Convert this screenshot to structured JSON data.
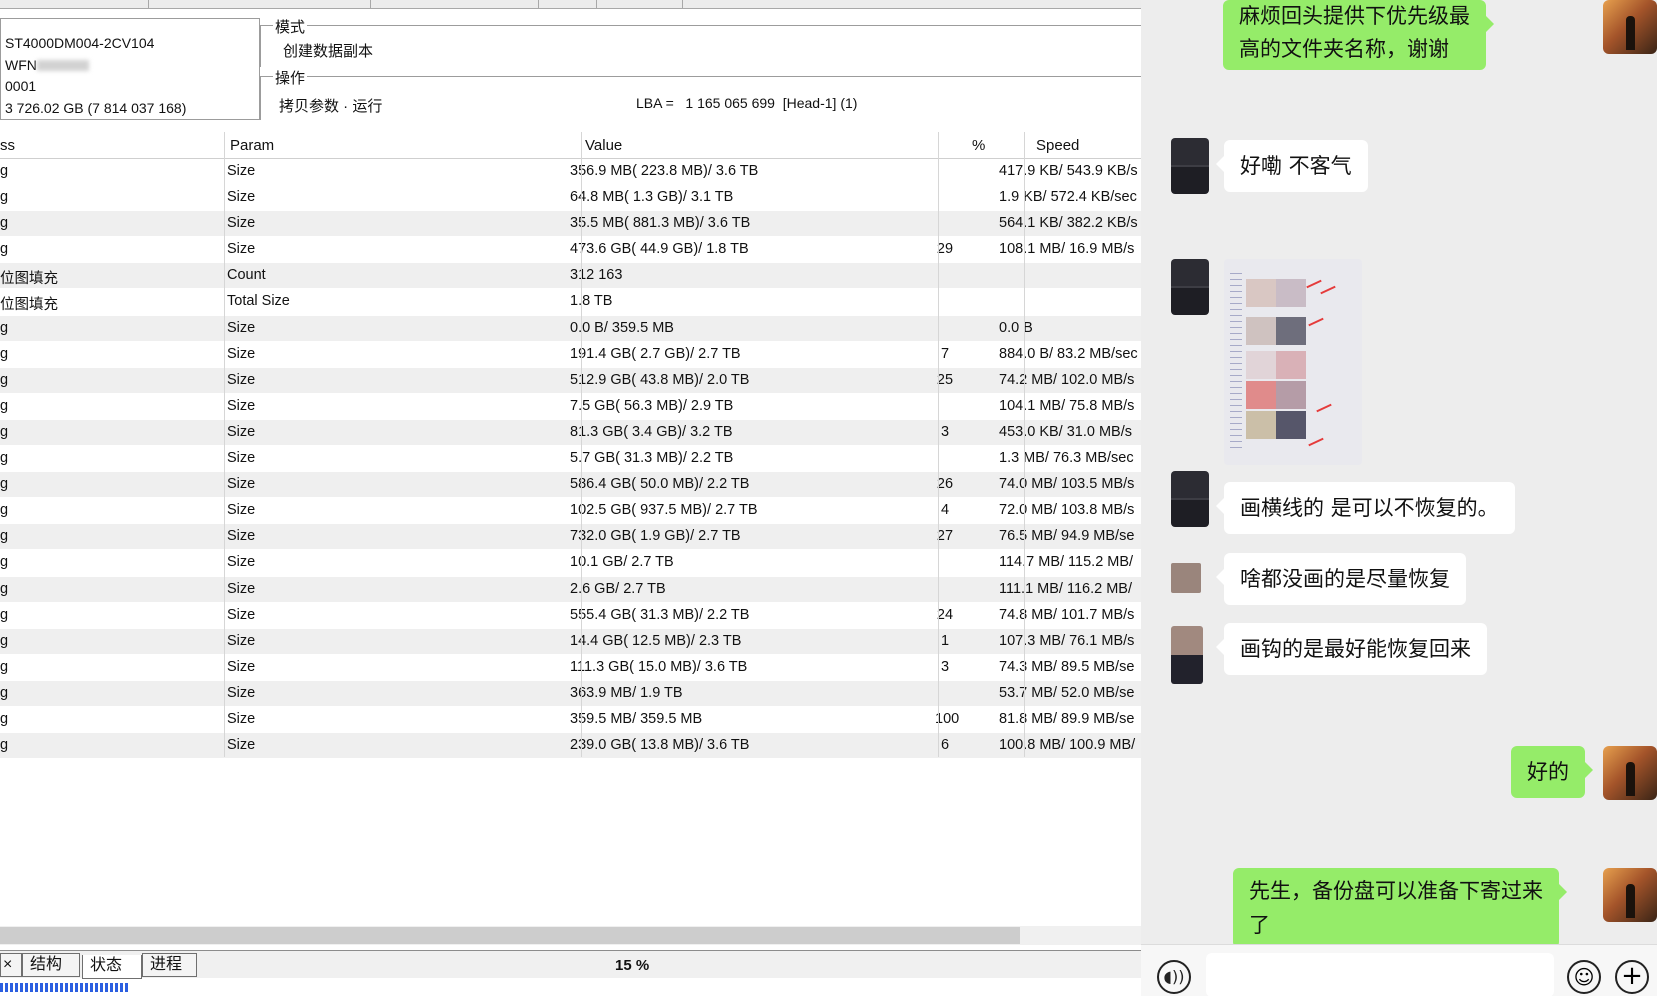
{
  "device": {
    "model": "ST4000DM004-2CV104",
    "serial_visible": "WFN",
    "firmware": "0001",
    "capacity": "3 726.02 GB (7 814 037 168)"
  },
  "mode": {
    "legend": "模式",
    "value": "创建数据副本"
  },
  "operation": {
    "legend": "操作",
    "value": "拷贝参数 · 运行",
    "lba": "LBA =   1 165 065 699  [Head-1] (1)"
  },
  "grid": {
    "headers": [
      "ss",
      "Param",
      "Value",
      "%",
      "Speed"
    ],
    "rows": [
      {
        "c0": "g",
        "param": "Size",
        "value": "356.9 MB( 223.8 MB)/ 3.6 TB",
        "pct": "",
        "speed": "417.9 KB/ 543.9 KB/s"
      },
      {
        "c0": "g",
        "param": "Size",
        "value": "64.8 MB( 1.3 GB)/ 3.1 TB",
        "pct": "",
        "speed": "1.9 KB/ 572.4 KB/sec"
      },
      {
        "c0": "g",
        "param": "Size",
        "value": "35.5 MB( 881.3 MB)/ 3.6 TB",
        "pct": "",
        "speed": "564.1 KB/ 382.2 KB/s"
      },
      {
        "c0": "g",
        "param": "Size",
        "value": "473.6 GB( 44.9 GB)/ 1.8 TB",
        "pct": "29",
        "speed": "108.1 MB/ 16.9 MB/s"
      },
      {
        "c0": "位图填充",
        "param": "Count",
        "value": "312 163",
        "pct": "",
        "speed": ""
      },
      {
        "c0": "位图填充",
        "param": "Total Size",
        "value": "1.8 TB",
        "pct": "",
        "speed": ""
      },
      {
        "c0": "g",
        "param": "Size",
        "value": "0.0 B/ 359.5 MB",
        "pct": "",
        "speed": "0.0 B"
      },
      {
        "c0": "g",
        "param": "Size",
        "value": "191.4 GB( 2.7 GB)/ 2.7 TB",
        "pct": "7",
        "speed": "884.0 B/ 83.2 MB/sec"
      },
      {
        "c0": "g",
        "param": "Size",
        "value": "512.9 GB( 43.8 MB)/ 2.0 TB",
        "pct": "25",
        "speed": "74.2 MB/ 102.0 MB/s"
      },
      {
        "c0": "g",
        "param": "Size",
        "value": "7.5 GB( 56.3 MB)/ 2.9 TB",
        "pct": "",
        "speed": "104.1 MB/ 75.8 MB/s"
      },
      {
        "c0": "g",
        "param": "Size",
        "value": "81.3 GB( 3.4 GB)/ 3.2 TB",
        "pct": "3",
        "speed": "453.0 KB/ 31.0 MB/s"
      },
      {
        "c0": "g",
        "param": "Size",
        "value": "5.7 GB( 31.3 MB)/ 2.2 TB",
        "pct": "",
        "speed": "1.3 MB/ 76.3 MB/sec"
      },
      {
        "c0": "g",
        "param": "Size",
        "value": "586.4 GB( 50.0 MB)/ 2.2 TB",
        "pct": "26",
        "speed": "74.0 MB/ 103.5 MB/s"
      },
      {
        "c0": "g",
        "param": "Size",
        "value": "102.5 GB( 937.5 MB)/ 2.7 TB",
        "pct": "4",
        "speed": "72.0 MB/ 103.8 MB/s"
      },
      {
        "c0": "g",
        "param": "Size",
        "value": "732.0 GB( 1.9 GB)/ 2.7 TB",
        "pct": "27",
        "speed": "76.5 MB/ 94.9 MB/se"
      },
      {
        "c0": "g",
        "param": "Size",
        "value": "10.1 GB/ 2.7 TB",
        "pct": "",
        "speed": "114.7 MB/ 115.2 MB/"
      },
      {
        "c0": "g",
        "param": "Size",
        "value": "2.6 GB/ 2.7 TB",
        "pct": "",
        "speed": "111.1 MB/ 116.2 MB/"
      },
      {
        "c0": "g",
        "param": "Size",
        "value": "555.4 GB( 31.3 MB)/ 2.2 TB",
        "pct": "24",
        "speed": "74.8 MB/ 101.7 MB/s"
      },
      {
        "c0": "g",
        "param": "Size",
        "value": "14.4 GB( 12.5 MB)/ 2.3 TB",
        "pct": "1",
        "speed": "107.3 MB/ 76.1 MB/s"
      },
      {
        "c0": "g",
        "param": "Size",
        "value": "111.3 GB( 15.0 MB)/ 3.6 TB",
        "pct": "3",
        "speed": "74.3 MB/ 89.5 MB/se"
      },
      {
        "c0": "g",
        "param": "Size",
        "value": "363.9 MB/ 1.9 TB",
        "pct": "",
        "speed": "53.7 MB/ 52.0 MB/se"
      },
      {
        "c0": "g",
        "param": "Size",
        "value": "359.5 MB/ 359.5 MB",
        "pct": "100",
        "speed": "81.8 MB/ 89.9 MB/se"
      },
      {
        "c0": "g",
        "param": "Size",
        "value": "239.0 GB( 13.8 MB)/ 3.6 TB",
        "pct": "6",
        "speed": "100.8 MB/ 100.9 MB/"
      }
    ]
  },
  "tabs": {
    "close": "×",
    "structure": "结构",
    "status": "状态",
    "process": "进程"
  },
  "progress": {
    "text": "15 %",
    "value": 0.15
  },
  "chat": {
    "messages": [
      {
        "from": "me",
        "text": "麻烦回头提供下优先级最\n高的文件夹名称，谢谢"
      },
      {
        "from": "other",
        "text": "好嘞  不客气"
      },
      {
        "from": "other",
        "type": "image"
      },
      {
        "from": "other",
        "text": "画横线的 是可以不恢复的。"
      },
      {
        "from": "other",
        "text": "啥都没画的是尽量恢复"
      },
      {
        "from": "other",
        "text": "画钩的是最好能恢复回来"
      },
      {
        "from": "me",
        "text": "好的"
      },
      {
        "from": "me",
        "text": "先生，备份盘可以准备下寄过来\n了"
      }
    ],
    "input_value": "",
    "icons": [
      "voice-icon",
      "emoji-icon",
      "plus-icon"
    ]
  }
}
